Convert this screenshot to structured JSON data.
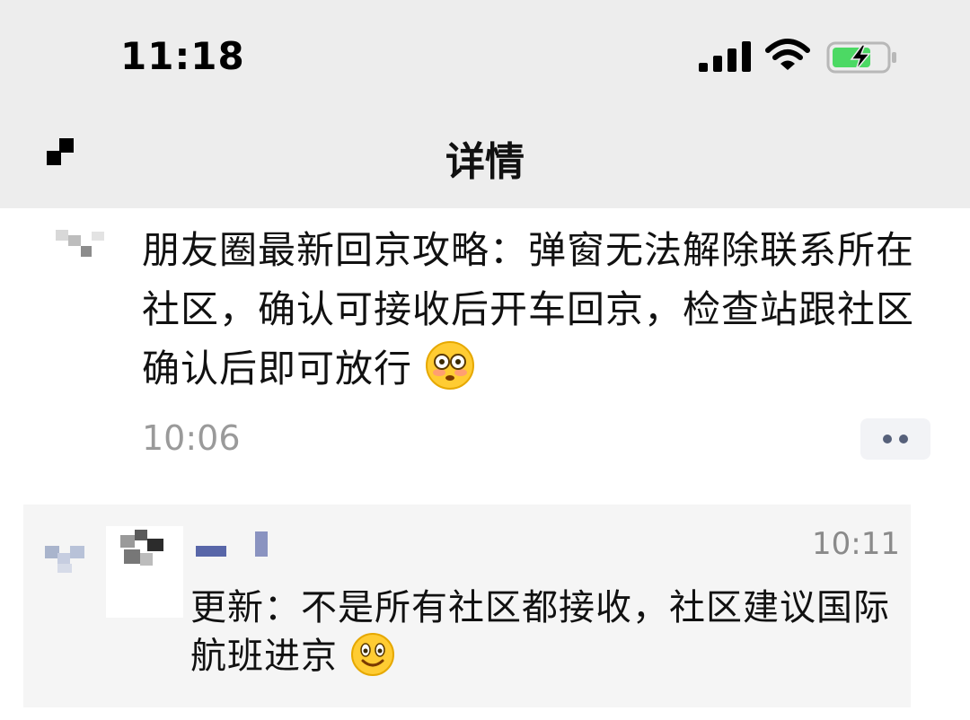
{
  "status_bar": {
    "time": "11:18",
    "icons": [
      "cellular-signal-icon",
      "wifi-icon",
      "battery-charging-icon"
    ],
    "battery_color": "#4cd964"
  },
  "nav": {
    "back_icon": "back-icon",
    "title": "详情"
  },
  "post": {
    "text": "朋友圈最新回京攻略：弹窗无法解除联系所在社区，确认可接收后开车回京，检查站跟社区确认后即可放行",
    "emoji": "flushed-face-emoji",
    "time": "10:06",
    "more_icon": "more-dots-icon"
  },
  "comment": {
    "icon": "comment-icon",
    "time": "10:11",
    "text": "更新：不是所有社区都接收，社区建议国际航班进京",
    "emoji": "smiling-face-emoji"
  },
  "colors": {
    "header_bg": "#ededed",
    "comment_bg": "#f5f5f5",
    "muted_text": "#9a9a9a",
    "link_blue": "#56607a"
  }
}
